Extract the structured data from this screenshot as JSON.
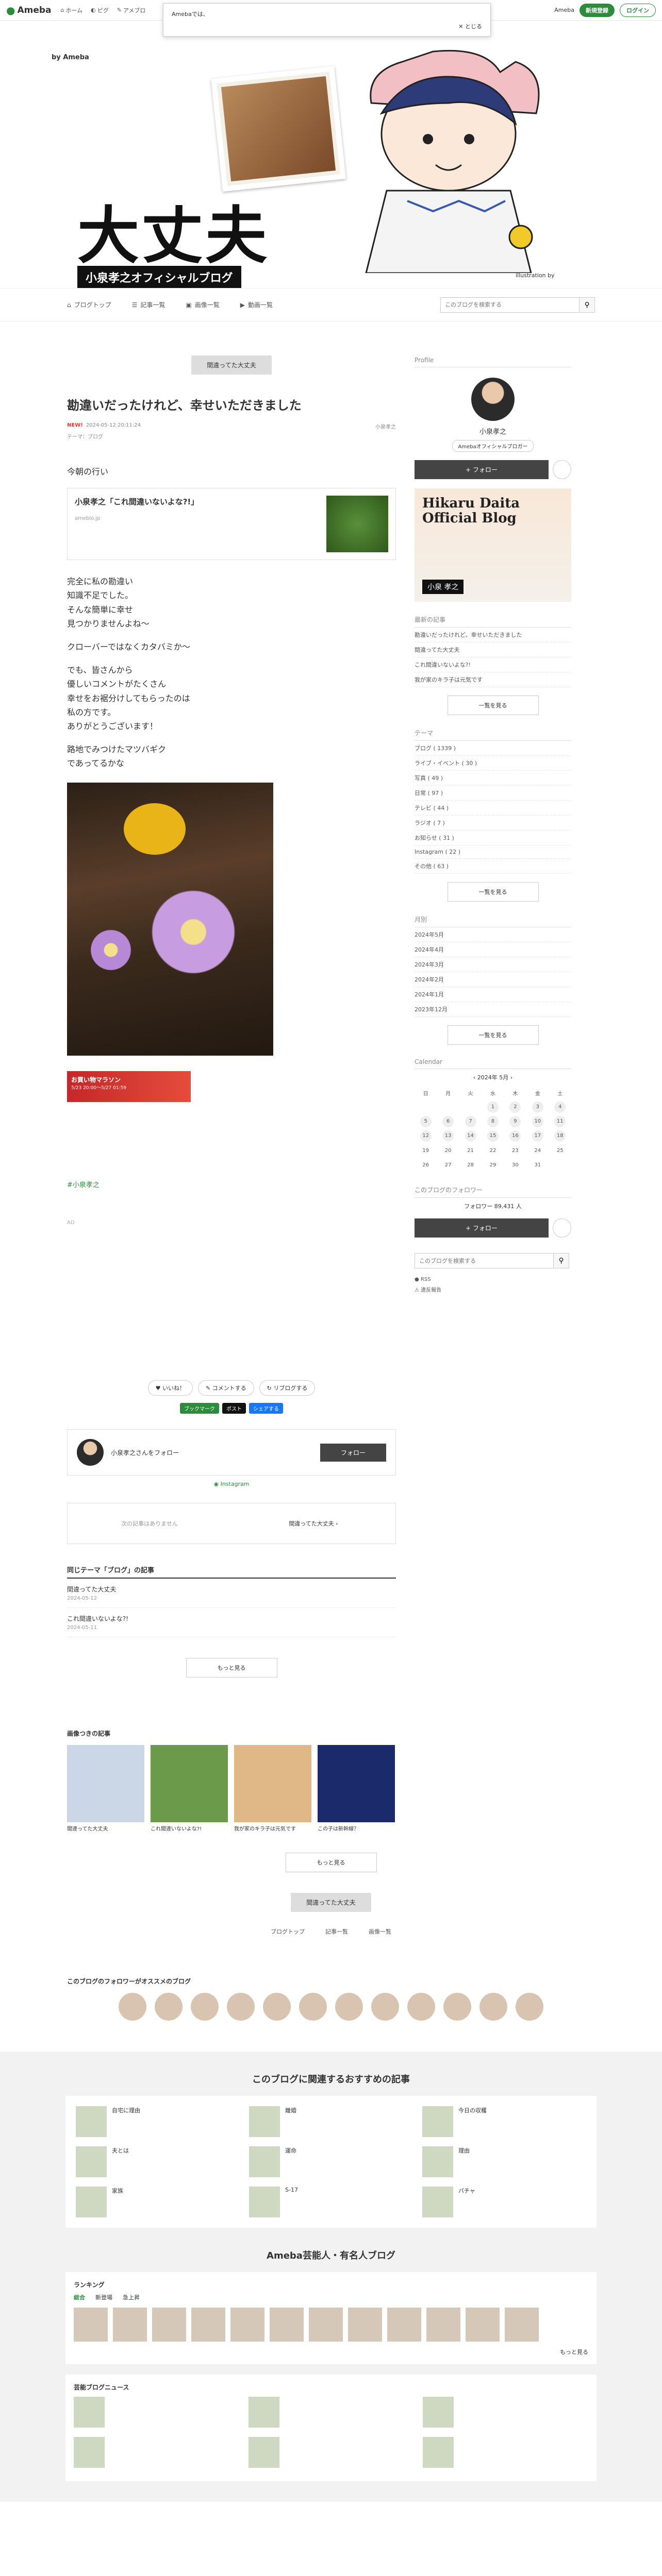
{
  "topbar": {
    "logo": "Ameba",
    "nav": [
      "ホーム",
      "ピグ",
      "アメブロ"
    ],
    "right": [
      "Ameba",
      "新規登録",
      "ログイン"
    ]
  },
  "cookie": {
    "text": "Amebaでは、",
    "close": "とじる"
  },
  "header": {
    "byameba": "by Ameba",
    "title": "大丈夫",
    "subtitle": "小泉孝之オフィシャルブログ",
    "credit": "illustration by"
  },
  "blognav": {
    "items": [
      "ブログトップ",
      "記事一覧",
      "画像一覧",
      "動画一覧"
    ],
    "search_placeholder": "このブログを検索する"
  },
  "entry": {
    "prev_button": "間違ってた大丈夫",
    "title": "勘違いだったけれど、幸せいただきました",
    "new_label": "NEW!",
    "date": "2024-05-12 20:11:24",
    "theme": "テーマ：ブログ",
    "author": "小泉孝之",
    "lead": "今朝の行い",
    "card_title": "小泉孝之「これ間違いないよな?!」",
    "card_source": "ameblo.jp",
    "para1": [
      "完全に私の勘違い",
      "知識不足でした。",
      "そんな簡単に幸せ",
      "見つかりませんよね〜"
    ],
    "para2": "クローバーではなくカタバミか〜",
    "para3": [
      "でも、皆さんから",
      "優しいコメントがたくさん",
      "幸せをお裾分けしてもらったのは",
      "私の方です。",
      "ありがとうございます！"
    ],
    "para4": [
      "路地でみつけたマツバギク",
      "であってるかな"
    ],
    "promo_title": "お買い物マラソン",
    "promo_date": "5/23 20:00〜5/27 01:59",
    "hashtag": "#小泉孝之",
    "ad_label": "AD"
  },
  "actions": {
    "like": "いいね！",
    "comment": "コメントする",
    "reblog": "リブログする",
    "share": [
      "ブックマーク",
      "ポスト",
      "シェアする"
    ],
    "follow_text": "小泉孝之さんをフォロー",
    "follow_btn": "フォロー",
    "instagram": "Instagram"
  },
  "navbox": {
    "left": "次の記事はありません",
    "right": "間違ってた大丈夫"
  },
  "themes": {
    "title": "同じテーマ「ブログ」の記事",
    "rows": [
      {
        "title": "間違ってた大丈夫",
        "date": "2024-05-12"
      },
      {
        "title": "これ間違いないよな?!",
        "date": "2024-05-11"
      }
    ],
    "more": "もっと見る"
  },
  "images": {
    "title": "画像つきの記事",
    "items": [
      "間違ってた大丈夫",
      "これ間違いないよな?!",
      "我が家のキラ子は元気です",
      "この子は新幹線？"
    ]
  },
  "pager": [
    "ブログトップ",
    "記事一覧",
    "画像一覧"
  ],
  "followers_title": "このブログのフォロワーがオススメのブログ",
  "side": {
    "profile_label": "Profile",
    "name": "小泉孝之",
    "badge": "Amebaオフィシャルブロガー",
    "follow": "フォロー",
    "banner_title": "Hikaru Daita Official Blog",
    "banner_name": "小泉 孝之",
    "recent_title": "最新の記事",
    "recent": [
      "勘違いだったけれど、幸せいただきました",
      "間違ってた大丈夫",
      "これ間違いないよな?!",
      "我が家のキラ子は元気です"
    ],
    "recent_more": "一覧を見る",
    "theme_title": "テーマ",
    "theme_list": [
      "ブログ ( 1339 )",
      "ライブ・イベント ( 30 )",
      "写真 ( 49 )",
      "日常 ( 97 )",
      "テレビ ( 44 )",
      "ラジオ ( 7 )",
      "お知らせ ( 31 )",
      "Instagram ( 22 )",
      "その他 ( 63 )"
    ],
    "theme_more": "一覧を見る",
    "month_title": "月別",
    "months": [
      "2024年5月",
      "2024年4月",
      "2024年3月",
      "2024年2月",
      "2024年1月",
      "2023年12月"
    ],
    "month_more": "一覧を見る",
    "cal_title": "Calendar",
    "cal_month": "2024年 5月",
    "cal_days": [
      "日",
      "月",
      "火",
      "水",
      "木",
      "金",
      "土"
    ],
    "cal_dates": [
      [
        "",
        "",
        "",
        "1",
        "2",
        "3",
        "4"
      ],
      [
        "5",
        "6",
        "7",
        "8",
        "9",
        "10",
        "11"
      ],
      [
        "12",
        "13",
        "14",
        "15",
        "16",
        "17",
        "18"
      ],
      [
        "19",
        "20",
        "21",
        "22",
        "23",
        "24",
        "25"
      ],
      [
        "26",
        "27",
        "28",
        "29",
        "30",
        "31",
        ""
      ]
    ],
    "follower_title": "このブログのフォロワー",
    "follower_count": "フォロワー 89,431 人",
    "follower_btn": "フォロー",
    "rss": "RSS",
    "report": "違反報告"
  },
  "recommend": {
    "title": "このブログに関連するおすすめの記事",
    "items": [
      {
        "t": "自宅に理由"
      },
      {
        "t": "離婚"
      },
      {
        "t": "今日の収穫"
      },
      {
        "t": "夫とは"
      },
      {
        "t": "運命"
      },
      {
        "t": "理由"
      },
      {
        "t": "家族"
      },
      {
        "t": "S-17"
      },
      {
        "t": "パチャ"
      }
    ]
  },
  "famous": {
    "title": "Ameba芸能人・有名人ブログ",
    "ranking": "ランキング",
    "tabs": [
      "総合",
      "新登場",
      "急上昇"
    ],
    "news": "芸能ブログニュース",
    "more": "もっと見る"
  }
}
